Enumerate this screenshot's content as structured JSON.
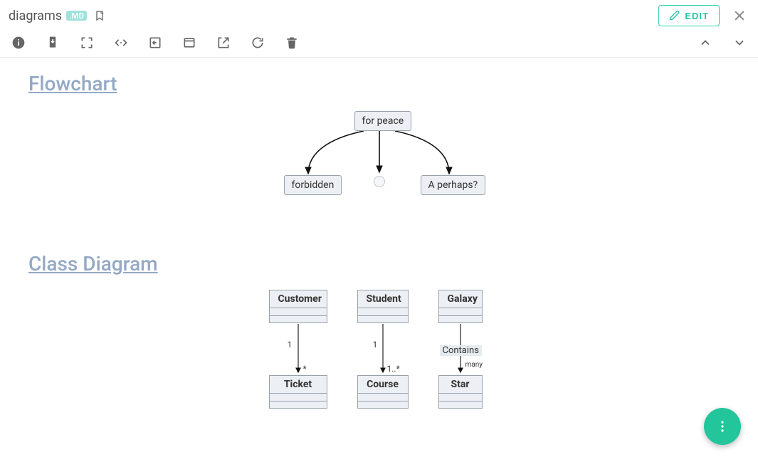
{
  "header": {
    "title": "diagrams",
    "badge": ".MD",
    "edit_label": "EDIT"
  },
  "sections": {
    "flowchart_title": "Flowchart",
    "class_diagram_title": "Class Diagram"
  },
  "flowchart": {
    "root": "for peace",
    "child_left": "forbidden",
    "child_right": "A perhaps?"
  },
  "classdiagram": {
    "pairs": [
      {
        "top": "Customer",
        "bottom": "Ticket",
        "m_top": "1",
        "m_bottom": "*"
      },
      {
        "top": "Student",
        "bottom": "Course",
        "m_top": "1",
        "m_bottom": "1..*"
      },
      {
        "top": "Galaxy",
        "bottom": "Star",
        "assoc": "Contains",
        "m_bottom": "many"
      }
    ]
  }
}
